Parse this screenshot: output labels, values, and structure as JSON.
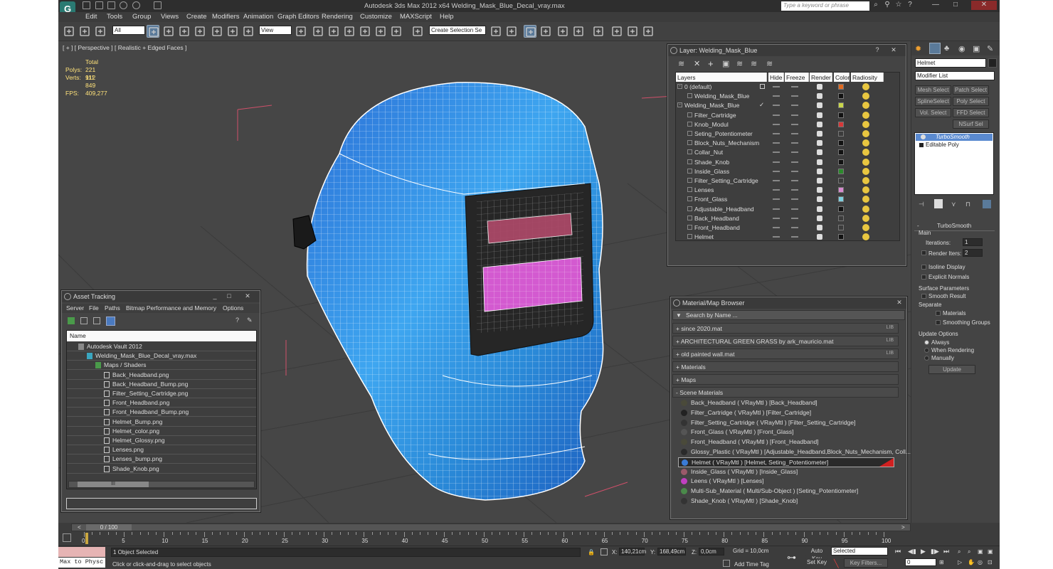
{
  "app": {
    "title": "Autodesk 3ds Max  2012 x64     Welding_Mask_Blue_Decal_vray.max",
    "search_placeholder": "Type a keyword or phrase",
    "logo": "G"
  },
  "menu": [
    "Edit",
    "Tools",
    "Group",
    "Views",
    "Create",
    "Modifiers",
    "Animation",
    "Graph Editors",
    "Rendering",
    "Customize",
    "MAXScript",
    "Help"
  ],
  "toolbar": {
    "filter": "All",
    "ref_coord": "View",
    "selection_set": "Create Selection Se"
  },
  "viewport": {
    "label": "[ + ] [ Perspective ] [ Realistic + Edged Faces ]",
    "stats": {
      "total_label": "Total",
      "polys_label": "Polys:",
      "polys": "221 912",
      "verts_label": "Verts:",
      "verts": "111 849",
      "fps_label": "FPS:",
      "fps": "409,277"
    }
  },
  "layer_panel": {
    "title": "Layer: Welding_Mask_Blue",
    "headers": [
      "Layers",
      "Hide",
      "Freeze",
      "Render",
      "Color",
      "Radiosity"
    ],
    "rows": [
      {
        "name": "0 (default)",
        "level": 0,
        "color": "#e06a20",
        "mark": "box"
      },
      {
        "name": "Welding_Mask_Blue",
        "level": 1,
        "color": "#111111",
        "mark": ""
      },
      {
        "name": "Welding_Mask_Blue",
        "level": 0,
        "color": "#c9d64a",
        "mark": "check"
      },
      {
        "name": "Filter_Cartridge",
        "level": 1,
        "color": "#111111",
        "mark": ""
      },
      {
        "name": "Knob_Modul",
        "level": 1,
        "color": "#d63838",
        "mark": ""
      },
      {
        "name": "Seting_Potentiometer",
        "level": 1,
        "color": "#3b3b3b",
        "mark": ""
      },
      {
        "name": "Block_Nuts_Mechanism",
        "level": 1,
        "color": "#111111",
        "mark": ""
      },
      {
        "name": "Collar_Nut",
        "level": 1,
        "color": "#111111",
        "mark": ""
      },
      {
        "name": "Shade_Knob",
        "level": 1,
        "color": "#111111",
        "mark": ""
      },
      {
        "name": "Inside_Glass",
        "level": 1,
        "color": "#2c8a2c",
        "mark": ""
      },
      {
        "name": "Filter_Setting_Cartridge",
        "level": 1,
        "color": "#3b3b3b",
        "mark": ""
      },
      {
        "name": "Lenses",
        "level": 1,
        "color": "#d88ad0",
        "mark": ""
      },
      {
        "name": "Front_Glass",
        "level": 1,
        "color": "#7fd0e0",
        "mark": ""
      },
      {
        "name": "Adjustable_Headband",
        "level": 1,
        "color": "#111111",
        "mark": ""
      },
      {
        "name": "Back_Headband",
        "level": 1,
        "color": "#3b3b3b",
        "mark": ""
      },
      {
        "name": "Front_Headband",
        "level": 1,
        "color": "#3b3b3b",
        "mark": ""
      },
      {
        "name": "Helmet",
        "level": 1,
        "color": "#111111",
        "mark": ""
      }
    ]
  },
  "asset_panel": {
    "title": "Asset Tracking",
    "menu": [
      "Server",
      "File",
      "Paths",
      "Bitmap Performance and Memory",
      "Options"
    ],
    "column": "Name",
    "tree": [
      {
        "name": "Autodesk Vault 2012",
        "level": 0,
        "icon": "vault"
      },
      {
        "name": "Welding_Mask_Blue_Decal_vray.max",
        "level": 1,
        "icon": "max"
      },
      {
        "name": "Maps / Shaders",
        "level": 2,
        "icon": "maps"
      },
      {
        "name": "Back_Headband.png",
        "level": 3,
        "icon": "file"
      },
      {
        "name": "Back_Headband_Bump.png",
        "level": 3,
        "icon": "file"
      },
      {
        "name": "Filter_Setting_Cartridge.png",
        "level": 3,
        "icon": "file"
      },
      {
        "name": "Front_Headband.png",
        "level": 3,
        "icon": "file"
      },
      {
        "name": "Front_Headband_Bump.png",
        "level": 3,
        "icon": "file"
      },
      {
        "name": "Helmet_Bump.png",
        "level": 3,
        "icon": "file"
      },
      {
        "name": "Helmet_color.png",
        "level": 3,
        "icon": "file"
      },
      {
        "name": "Helmet_Glossy.png",
        "level": 3,
        "icon": "file"
      },
      {
        "name": "Lenses.png",
        "level": 3,
        "icon": "file"
      },
      {
        "name": "Lenses_bump.png",
        "level": 3,
        "icon": "file"
      },
      {
        "name": "Shade_Knob.png",
        "level": 3,
        "icon": "file"
      }
    ],
    "scroll_marker": "III"
  },
  "material_panel": {
    "title": "Material/Map Browser",
    "search": "Search by Name ...",
    "libraries": [
      {
        "name": "+ since 2020.mat",
        "tag": "LIB"
      },
      {
        "name": "+ ARCHITECTURAL GREEN GRASS by ark_mauricio.mat",
        "tag": "LIB"
      },
      {
        "name": "+ old painted wall.mat",
        "tag": "LIB"
      }
    ],
    "groups": [
      "+ Materials",
      "+ Maps",
      "- Scene Materials"
    ],
    "scene_materials": [
      {
        "name": "Back_Headband  ( VRayMtl ) [Back_Headband]",
        "swatch": "#4a4a3a"
      },
      {
        "name": "Filter_Cartridge  ( VRayMtl ) [Filter_Cartridge]",
        "swatch": "#222222"
      },
      {
        "name": "Filter_Setting_Cartridge  ( VRayMtl ) [Filter_Setting_Cartridge]",
        "swatch": "#333333"
      },
      {
        "name": "Front_Glass  ( VRayMtl ) [Front_Glass]",
        "swatch": "#555555"
      },
      {
        "name": "Front_Headband  ( VRayMtl ) [Front_Headband]",
        "swatch": "#4a4a3a"
      },
      {
        "name": "Glossy_Plastic  ( VRayMtl ) [Adjustable_Headband,Block_Nuts_Mechanism, Coll...",
        "swatch": "#2a2a2a"
      },
      {
        "name": "Helmet  ( VRayMtl ) [Helmet, Seting_Potentiometer]",
        "swatch": "#3a7bd5"
      },
      {
        "name": "Inside_Glass  ( VRayMtl ) [Inside_Glass]",
        "swatch": "#9a5a6a"
      },
      {
        "name": "Leens  ( VRayMtl ) [Lenses]",
        "swatch": "#c040c0"
      },
      {
        "name": "Multi-Sub_Material  ( Multi/Sub-Object ) [Seting_Potentiometer]",
        "swatch": "#4a8a4a"
      },
      {
        "name": "Shade_Knob  ( VRayMtl ) [Shade_Knob]",
        "swatch": "#333333"
      }
    ]
  },
  "command_panel": {
    "object_name": "Helmet",
    "modifier_list": "Modifier List",
    "mod_buttons": [
      "Mesh Select",
      "Patch Select",
      "SplineSelect",
      "Poly Select",
      "Vol. Select",
      "FFD Select",
      "NSurf Sel"
    ],
    "stack": [
      "TurboSmooth",
      "Editable Poly"
    ],
    "rollout": "TurboSmooth",
    "main": "Main",
    "iterations_label": "Iterations:",
    "iterations": "1",
    "render_iters_label": "Render Iters:",
    "render_iters": "2",
    "isoline": "Isoline Display",
    "explicit": "Explicit Normals",
    "surface": "Surface Parameters",
    "smooth_result": "Smooth Result",
    "separate": "Separate",
    "materials": "Materials",
    "smoothing_groups": "Smoothing Groups",
    "update_options": "Update Options",
    "always": "Always",
    "when_rendering": "When Rendering",
    "manually": "Manually",
    "update": "Update"
  },
  "timeline": {
    "frame_label": "0 / 100",
    "ticks": [
      "0",
      "5",
      "10",
      "15",
      "20",
      "25",
      "30",
      "35",
      "40",
      "45",
      "50",
      "55",
      "60",
      "65",
      "70",
      "75",
      "80",
      "85",
      "90",
      "95",
      "100"
    ]
  },
  "status": {
    "script": "Max to Physc",
    "selected": "1 Object Selected",
    "hint": "Click or click-and-drag to select objects",
    "x_label": "X:",
    "x": "140,21cm",
    "y_label": "Y:",
    "y": "168,49cm",
    "z_label": "Z:",
    "z": "0,0cm",
    "grid": "Grid = 10,0cm",
    "add_time_tag": "Add Time Tag",
    "auto_key": "Auto Key",
    "set_key": "Set Key",
    "key_mode": "Selected",
    "key_filters": "Key Filters...",
    "frame": "0"
  }
}
